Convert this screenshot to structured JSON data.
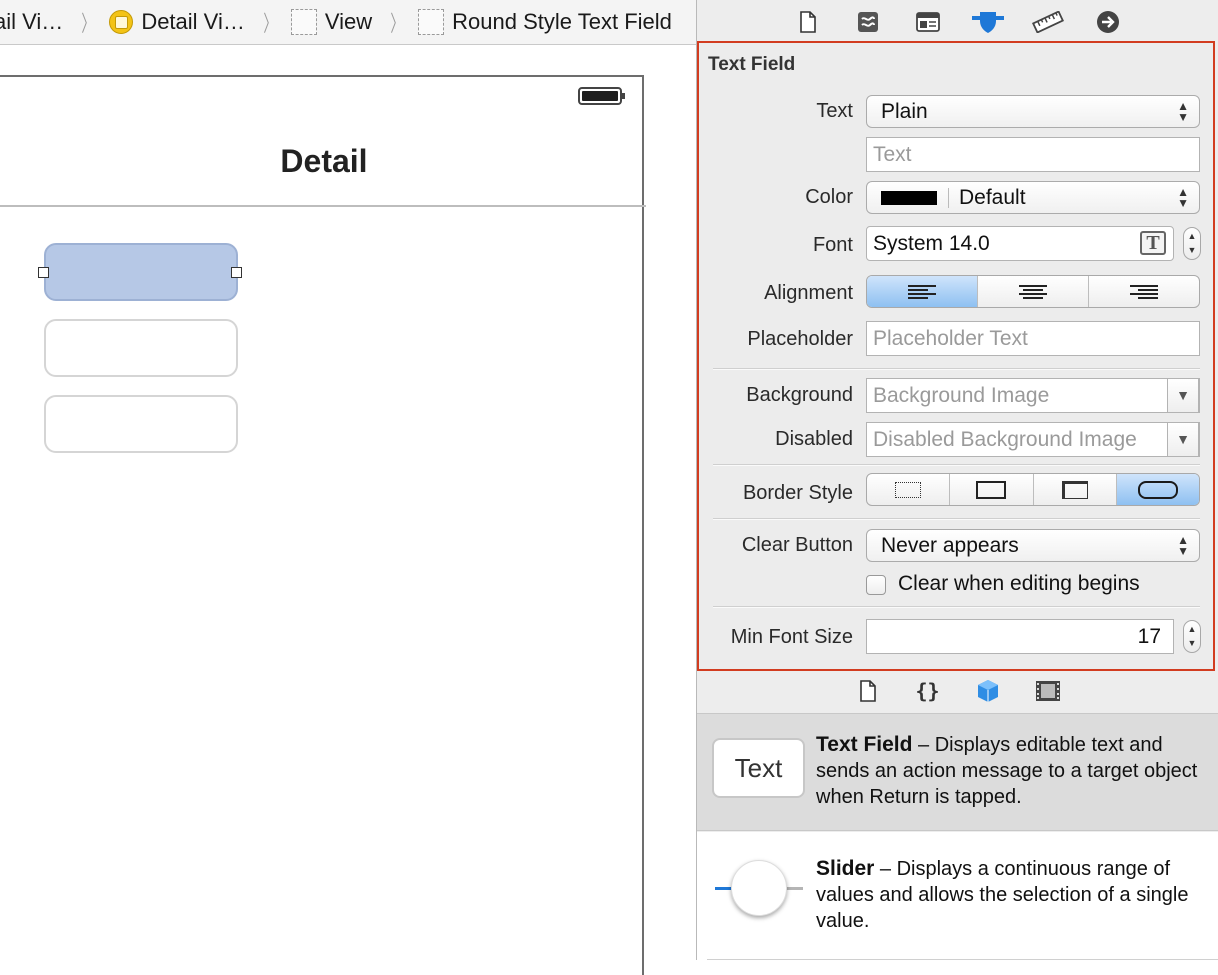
{
  "jumpbar": {
    "crumbs": [
      {
        "label": "ail Vi…",
        "icon": "none"
      },
      {
        "label": "Detail Vi…",
        "icon": "view-controller-icon"
      },
      {
        "label": "View",
        "icon": "view-icon"
      },
      {
        "label": "Round Style Text Field",
        "icon": "view-icon"
      }
    ]
  },
  "scene": {
    "nav_title": "Detail",
    "text_fields": 3
  },
  "inspector": {
    "tabs": [
      "file-inspector-icon",
      "quick-help-icon",
      "identity-inspector-icon",
      "attributes-inspector-icon",
      "size-inspector-icon",
      "connections-inspector-icon"
    ],
    "active_tab": "attributes-inspector-icon",
    "section_title": "Text Field",
    "labels": {
      "text": "Text",
      "color": "Color",
      "font": "Font",
      "alignment": "Alignment",
      "placeholder": "Placeholder",
      "background": "Background",
      "disabled": "Disabled",
      "border_style": "Border Style",
      "clear_button": "Clear Button",
      "min_font_size": "Min Font Size"
    },
    "values": {
      "text_type": "Plain",
      "text_placeholder": "Text",
      "color": "Default",
      "color_swatch": "#000000",
      "font": "System 14.0",
      "alignment_selected": "left",
      "placeholder_placeholder": "Placeholder Text",
      "background_placeholder": "Background Image",
      "disabled_placeholder": "Disabled Background Image",
      "border_style_selected": "rounded",
      "clear_button": "Never appears",
      "clear_when_editing": "Clear when editing begins",
      "clear_when_editing_checked": false,
      "min_font_size": "17"
    }
  },
  "library": {
    "tabs": [
      "file-template-icon",
      "code-snippet-icon",
      "object-library-icon",
      "media-library-icon"
    ],
    "active_tab": "object-library-icon",
    "items": [
      {
        "name": "Text Field",
        "desc": " – Displays editable text and sends an action message to a target object when Return is tapped.",
        "thumb": "Text"
      },
      {
        "name": "Slider",
        "desc": " – Displays a continuous range of values and allows the selection of a single value."
      }
    ]
  },
  "colors": {
    "selection_highlight": "#d23c20",
    "selected_field": "#b6c8e6",
    "accent_blue": "#1e78d7"
  }
}
